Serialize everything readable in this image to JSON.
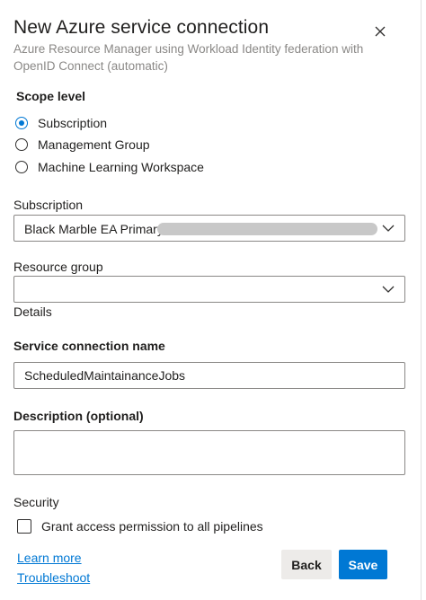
{
  "header": {
    "title": "New Azure service connection",
    "subtitle": "Azure Resource Manager using Workload Identity federation with OpenID Connect (automatic)",
    "close_icon": "close-icon"
  },
  "scope": {
    "label": "Scope level",
    "options": [
      {
        "label": "Subscription",
        "checked": true
      },
      {
        "label": "Management Group",
        "checked": false
      },
      {
        "label": "Machine Learning Workspace",
        "checked": false
      }
    ]
  },
  "subscription": {
    "label": "Subscription",
    "value": "Black Marble EA Primary"
  },
  "resource_group": {
    "label": "Resource group",
    "value": ""
  },
  "details": {
    "label": "Details"
  },
  "service_connection_name": {
    "label": "Service connection name",
    "value": "ScheduledMaintainanceJobs"
  },
  "description": {
    "label": "Description (optional)",
    "value": ""
  },
  "security": {
    "label": "Security",
    "grant_access_label": "Grant access permission to all pipelines",
    "checked": false
  },
  "links": {
    "learn_more": "Learn more",
    "troubleshoot": "Troubleshoot"
  },
  "buttons": {
    "back": "Back",
    "save": "Save"
  },
  "colors": {
    "accent": "#0078d4",
    "text": "#201f1e",
    "secondary_text": "#8a8886"
  }
}
